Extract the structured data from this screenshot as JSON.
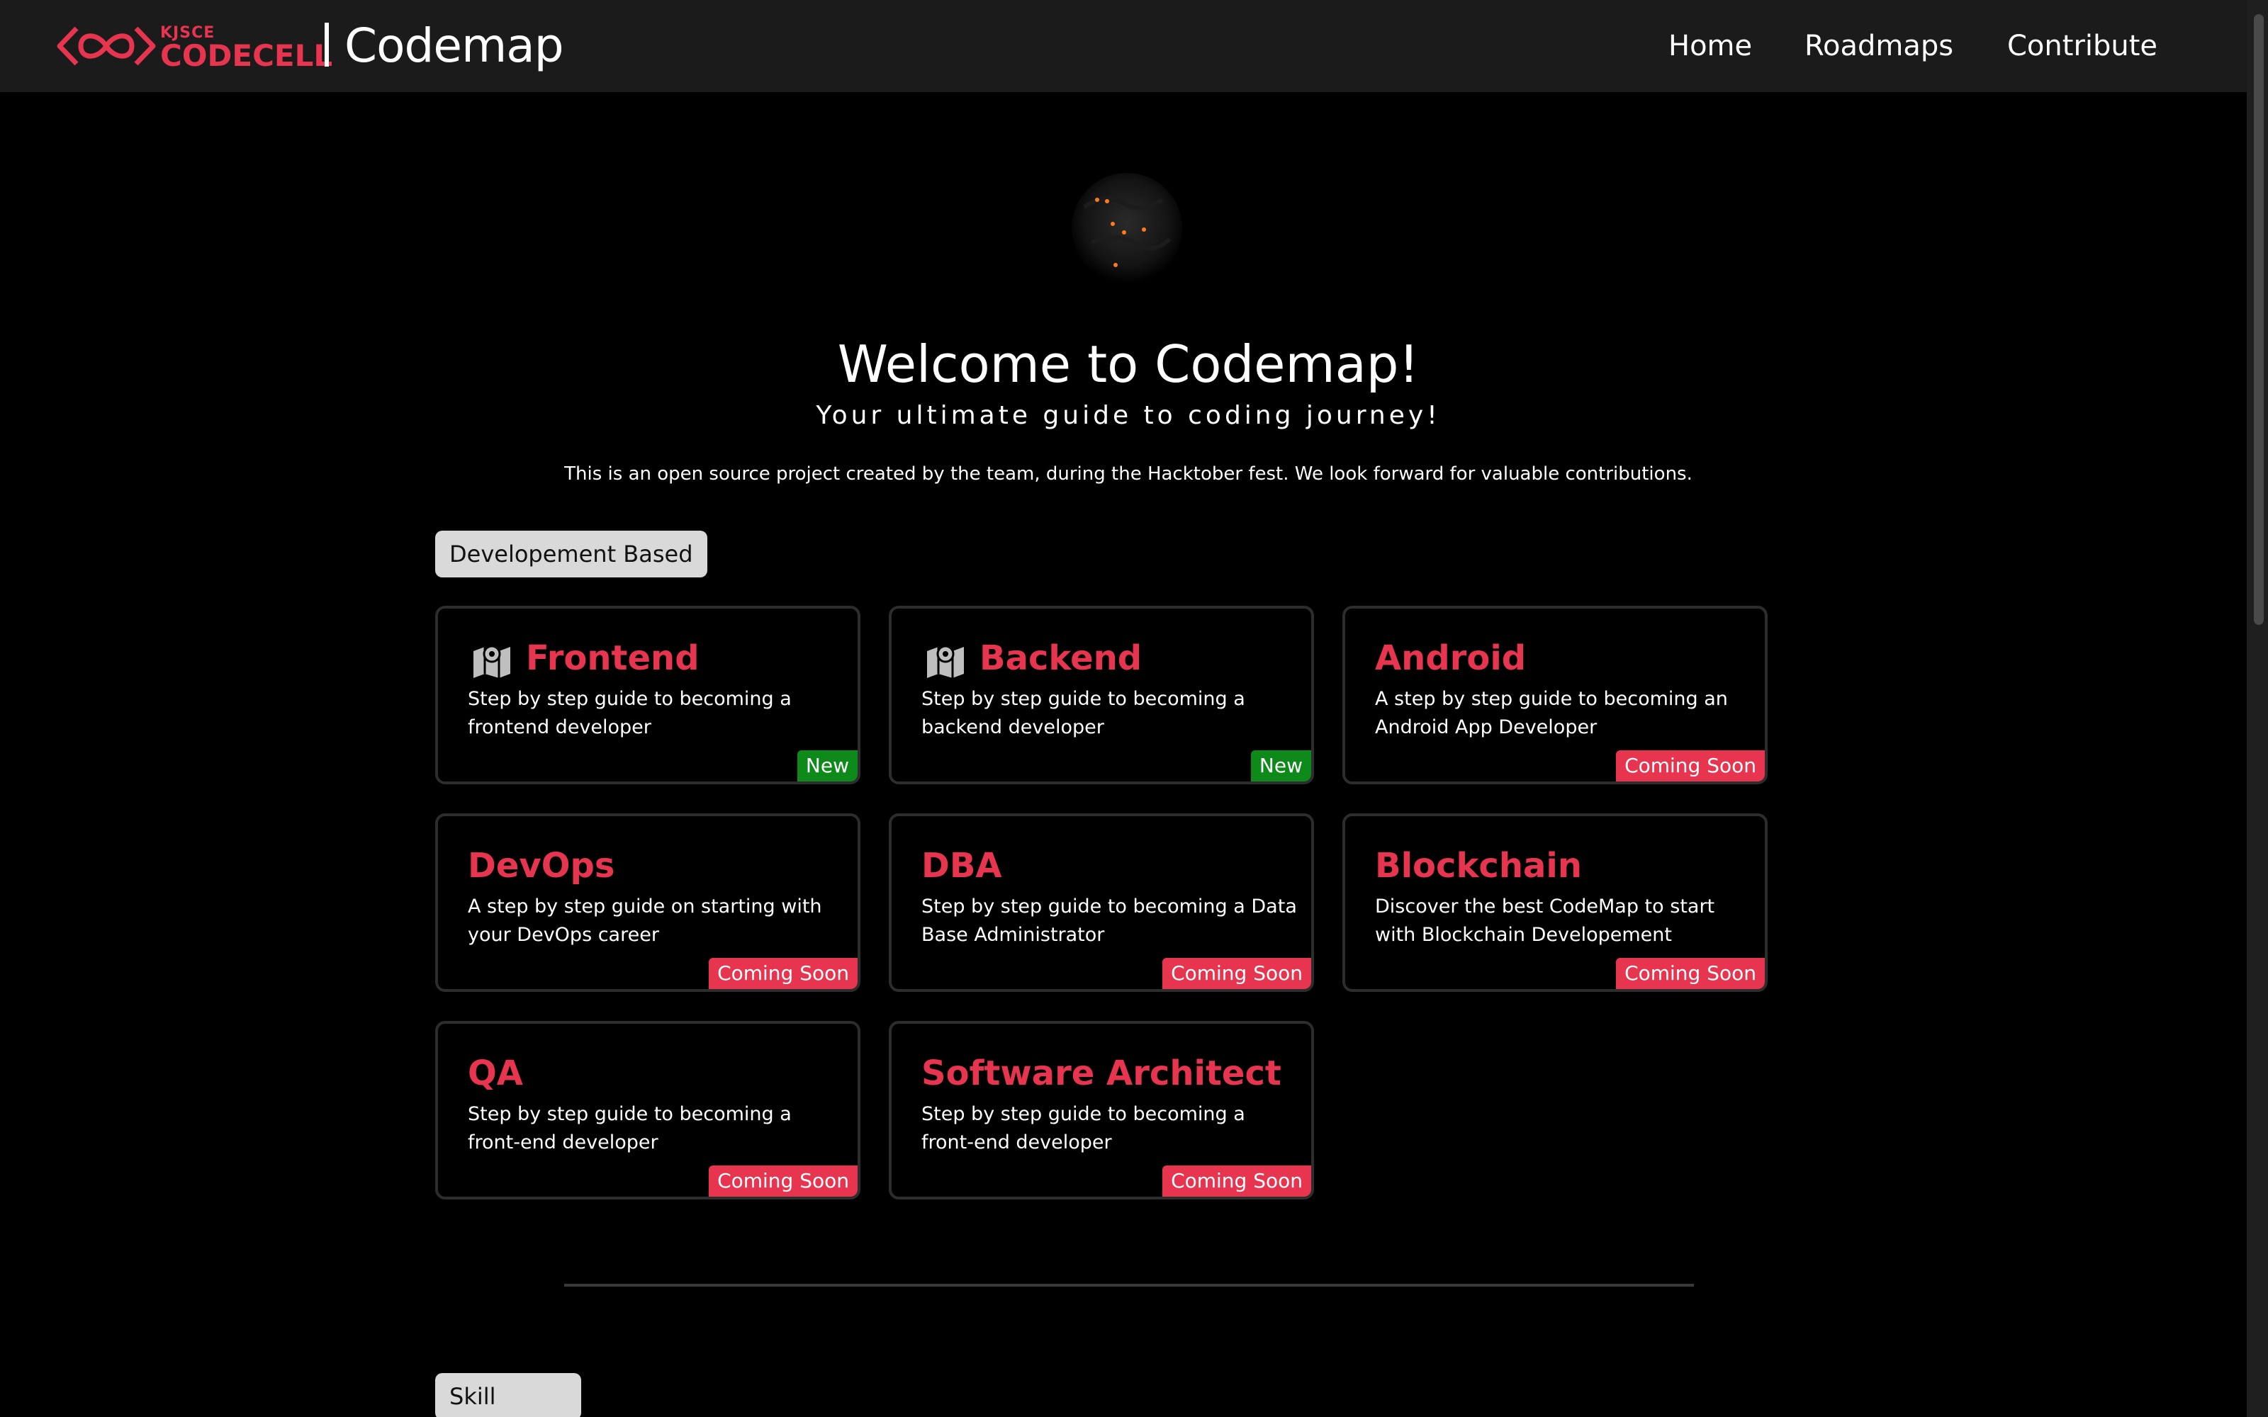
{
  "nav": {
    "logo_small": "KJSCE",
    "logo_big": "CODECELL",
    "brand_title": "Codemap",
    "links": [
      "Home",
      "Roadmaps",
      "Contribute"
    ]
  },
  "hero": {
    "title": "Welcome to Codemap!",
    "subtitle": "Your ultimate guide to coding journey!",
    "description": "This is an open source project created by the team, during the Hacktober fest. We look forward for valuable contributions."
  },
  "sections": {
    "development_label": "Developement Based",
    "skill_label": "Skill Based"
  },
  "cards": [
    {
      "title": "Frontend",
      "description": "Step by step guide to becoming a frontend developer",
      "badge": "New",
      "icon": "map-icon"
    },
    {
      "title": "Backend",
      "description": "Step by step guide to becoming a backend developer",
      "badge": "New",
      "icon": "map-icon"
    },
    {
      "title": "Android",
      "description": "A step by step guide to becoming an Android App Developer",
      "badge": "Coming Soon"
    },
    {
      "title": "DevOps",
      "description": "A step by step guide on starting with your DevOps career",
      "badge": "Coming Soon"
    },
    {
      "title": "DBA",
      "description": "Step by step guide to becoming a Data Base Administrator",
      "badge": "Coming Soon"
    },
    {
      "title": "Blockchain",
      "description": "Discover the best CodeMap to start with Blockchain Developement",
      "badge": "Coming Soon"
    },
    {
      "title": "QA",
      "description": "Step by step guide to becoming a front-end developer",
      "badge": "Coming Soon"
    },
    {
      "title": "Software Architect",
      "description": "Step by step guide to becoming a front-end developer",
      "badge": "Coming Soon"
    }
  ],
  "colors": {
    "accent": "#e8354f",
    "new_badge": "#0d8a19",
    "navbar_bg": "#1b1b1b",
    "page_bg": "#000000"
  }
}
